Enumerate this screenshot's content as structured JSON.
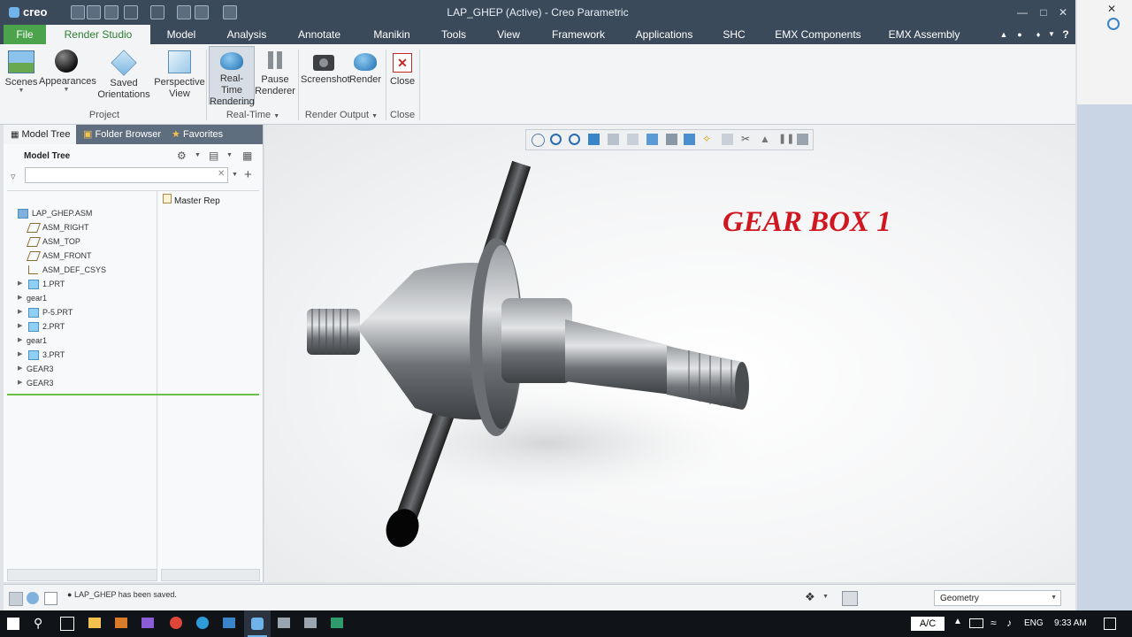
{
  "app": {
    "logo": "creo",
    "window_title": "LAP_GHEP (Active) - Creo Parametric"
  },
  "menu": {
    "file": "File",
    "tabs": [
      "Render Studio",
      "Model",
      "Analysis",
      "Annotate",
      "Manikin",
      "Tools",
      "View",
      "Framework",
      "Applications",
      "SHC",
      "EMX Components",
      "EMX Assembly"
    ]
  },
  "ribbon": {
    "buttons": {
      "scenes": "Scenes",
      "appearances": "Appearances",
      "saved_orientations": "Saved\nOrientations",
      "perspective_view": "Perspective\nView",
      "realtime_rendering": "Real-Time\nRendering",
      "pause_renderer": "Pause\nRenderer",
      "screenshot": "Screenshot",
      "render": "Render",
      "close": "Close"
    },
    "groups": {
      "project": "Project",
      "realtime": "Real-Time",
      "render_output": "Render Output",
      "close": "Close"
    }
  },
  "panel": {
    "tabs": [
      "Model Tree",
      "Folder Browser",
      "Favorites"
    ],
    "header": "Model Tree",
    "column_header": "Master Rep",
    "search_placeholder": "",
    "tree": [
      {
        "label": "LAP_GHEP.ASM",
        "level": 0,
        "expand": false,
        "icon": "assembly"
      },
      {
        "label": "ASM_RIGHT",
        "level": 1,
        "expand": false,
        "icon": "plane"
      },
      {
        "label": "ASM_TOP",
        "level": 1,
        "expand": false,
        "icon": "plane"
      },
      {
        "label": "ASM_FRONT",
        "level": 1,
        "expand": false,
        "icon": "plane"
      },
      {
        "label": "ASM_DEF_CSYS",
        "level": 1,
        "expand": false,
        "icon": "csys"
      },
      {
        "label": "1.PRT",
        "level": 1,
        "expand": true,
        "icon": "part"
      },
      {
        "label": "gear1",
        "level": 0,
        "expand": true,
        "icon": "none"
      },
      {
        "label": "P-5.PRT",
        "level": 1,
        "expand": true,
        "icon": "part"
      },
      {
        "label": "2.PRT",
        "level": 1,
        "expand": true,
        "icon": "part"
      },
      {
        "label": "gear1",
        "level": 0,
        "expand": true,
        "icon": "none"
      },
      {
        "label": "3.PRT",
        "level": 1,
        "expand": true,
        "icon": "part"
      },
      {
        "label": "GEAR3",
        "level": 0,
        "expand": true,
        "icon": "none"
      },
      {
        "label": "GEAR3",
        "level": 0,
        "expand": true,
        "icon": "none"
      }
    ]
  },
  "viewport": {
    "model_title": "GEAR BOX 1"
  },
  "status": {
    "message": "LAP_GHEP has been saved.",
    "filter_value": "Geometry"
  },
  "taskbar": {
    "ac": "A/C",
    "lang": "ENG",
    "time": "9:33 AM"
  },
  "colors": {
    "title_red": "#d0161e",
    "file_tab": "#4ba34b",
    "active_tab_text": "#2e7d32",
    "chrome": "#3b4a5a"
  }
}
